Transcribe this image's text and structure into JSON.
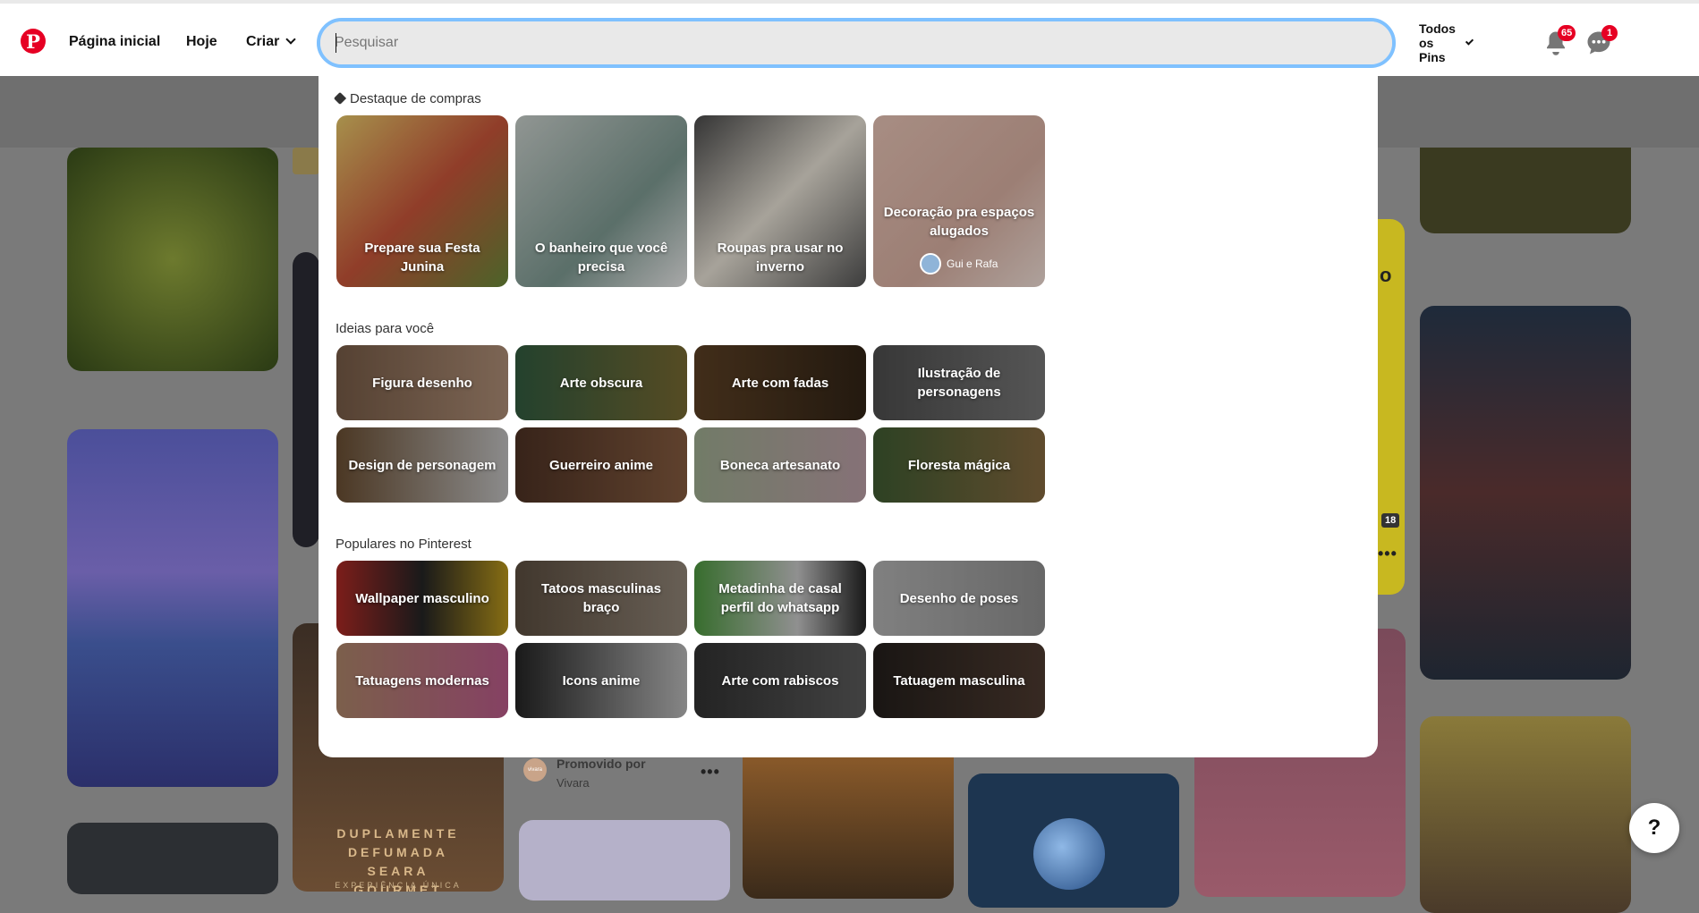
{
  "header": {
    "logo_glyph": "P",
    "nav": {
      "home": "Página inicial",
      "today": "Hoje",
      "create": "Criar"
    },
    "search": {
      "placeholder": "Pesquisar",
      "value": ""
    },
    "filter_label": "Todos os Pins",
    "notifications_count": "65",
    "messages_count": "1",
    "icons": [
      "pinterest-logo-icon",
      "chevron-down-icon",
      "bell-icon",
      "chat-bubble-icon"
    ]
  },
  "dropdown": {
    "shopping": {
      "title": "Destaque de compras",
      "items": [
        {
          "label": "Prepare sua Festa Junina"
        },
        {
          "label": "O banheiro que você precisa"
        },
        {
          "label": "Roupas pra usar no inverno"
        },
        {
          "label": "Decoração pra espaços alugados",
          "creator": "Gui e Rafa"
        }
      ]
    },
    "ideas": {
      "title": "Ideias para você",
      "items": [
        {
          "label": "Figura desenho"
        },
        {
          "label": "Arte obscura"
        },
        {
          "label": "Arte com fadas"
        },
        {
          "label": "Ilustração de personagens"
        },
        {
          "label": "Design de personagem"
        },
        {
          "label": "Guerreiro anime"
        },
        {
          "label": "Boneca artesanato"
        },
        {
          "label": "Floresta mágica"
        }
      ]
    },
    "popular": {
      "title": "Populares no Pinterest",
      "items": [
        {
          "label": "Wallpaper masculino"
        },
        {
          "label": "Tatoos masculinas braço"
        },
        {
          "label": "Metadinha de casal perfil do whatsapp"
        },
        {
          "label": "Desenho de poses"
        },
        {
          "label": "Tatuagens modernas"
        },
        {
          "label": "Icons anime"
        },
        {
          "label": "Arte com rabiscos"
        },
        {
          "label": "Tatuagem masculina"
        }
      ]
    }
  },
  "feed": {
    "promoted_label": "Promovido por",
    "promoted_brand": "Vivara",
    "promoted_avatar_text": "vivara",
    "ad_text": "DUPLAMENTE DEFUMADA SEARA GOURMET",
    "ad_subtext": "EXPERIÊNCIA ÚNICA",
    "yellow_pin_letter": "o",
    "yellow_pin_count": "18",
    "more_glyph": "•••"
  },
  "help_button": "?",
  "colors": {
    "brand": "#e60023",
    "search_focus": "#7fc1ff",
    "search_bg": "#e9e9e9"
  }
}
